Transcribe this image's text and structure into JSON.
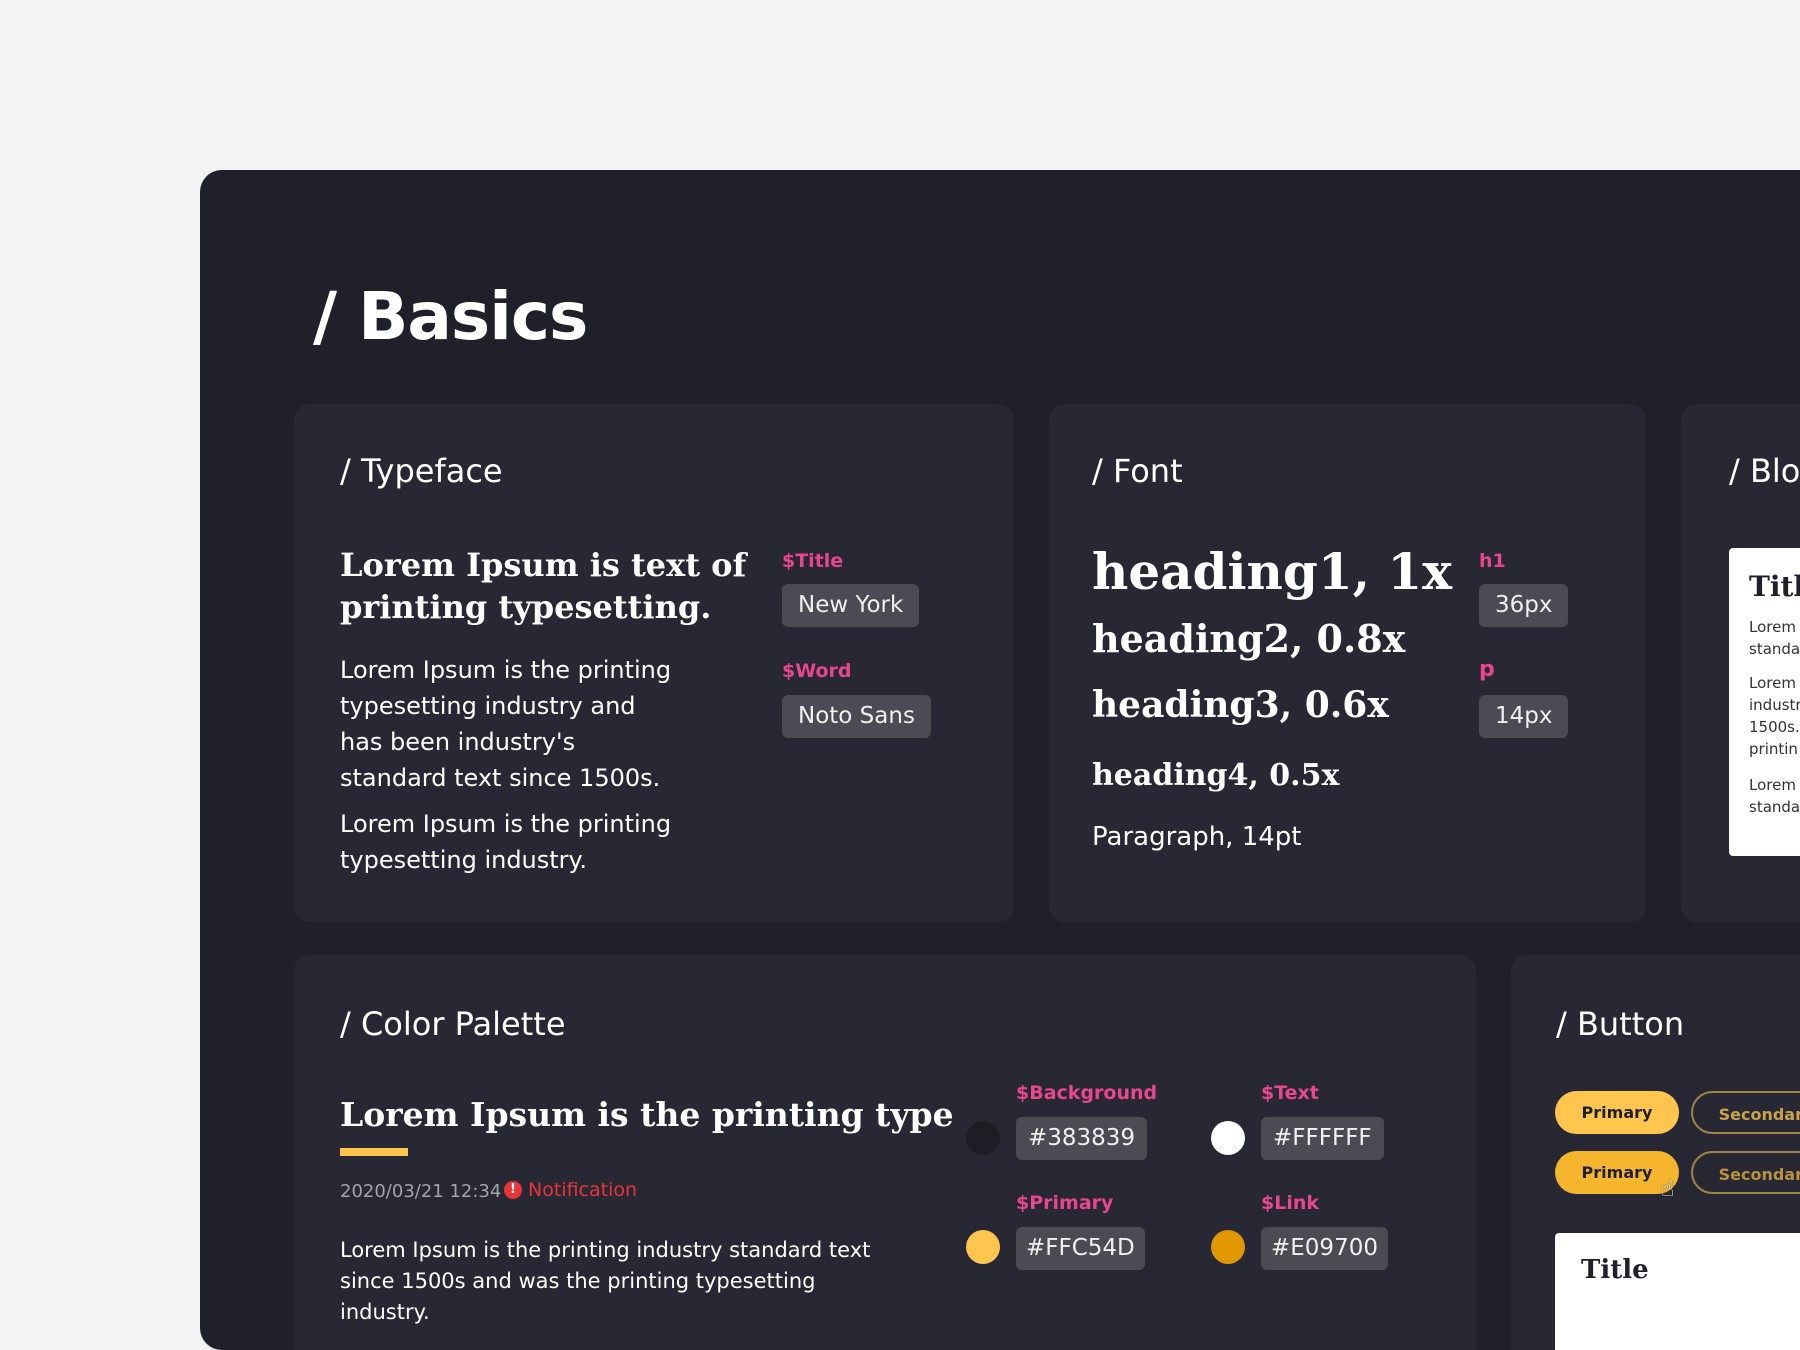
{
  "page_title": "/ Basics",
  "typeface": {
    "title": "/ Typeface",
    "heading": "Lorem Ipsum is text of printing typesetting.",
    "para1": "Lorem Ipsum is the printing typesetting industry and  has been industry's standard text since 1500s.",
    "para2": "Lorem Ipsum is the printing typesetting industry.",
    "title_tag": "$Title",
    "title_font": "New York",
    "word_tag": "$Word",
    "word_font": "Noto Sans"
  },
  "font": {
    "title": "/ Font",
    "h1": "heading1, 1x",
    "h2": "heading2, 0.8x",
    "h3": "heading3, 0.6x",
    "h4": "heading4, 0.5x",
    "p": "Paragraph, 14pt",
    "h1_tag": "h1",
    "h1_size": "36px",
    "p_tag": "p",
    "p_size": "14px"
  },
  "block": {
    "title": "/ Blo",
    "card_title": "Title",
    "line1a": "Lorem",
    "line1b": "standa",
    "line2a": "Lorem",
    "line2b": "industr",
    "line2c": "1500s.",
    "line2d": "printin",
    "line3a": "Lorem",
    "line3b": "standa"
  },
  "palette": {
    "title": "/ Color Palette",
    "heading": "Lorem Ipsum is the printing type",
    "timestamp": "2020/03/21 12:34",
    "notification": "Notification",
    "body": "Lorem Ipsum is the printing industry  standard text  since 1500s and was the printing typesetting industry.",
    "colors": [
      {
        "tag": "$Background",
        "hex": "#383839",
        "swatch": "#1d1e24"
      },
      {
        "tag": "$Text",
        "hex": "#FFFFFF",
        "swatch": "#ffffff"
      },
      {
        "tag": "$Primary",
        "hex": "#FFC54D",
        "swatch": "#ffc54d"
      },
      {
        "tag": "$Link",
        "hex": "#E09700",
        "swatch": "#e09700"
      }
    ],
    "accent_color": "#ffc54d",
    "notification_color": "#e8353a"
  },
  "button": {
    "title": "/ Button",
    "primary_label": "Primary",
    "secondary_label": "Secondary",
    "card_title": "Title"
  }
}
